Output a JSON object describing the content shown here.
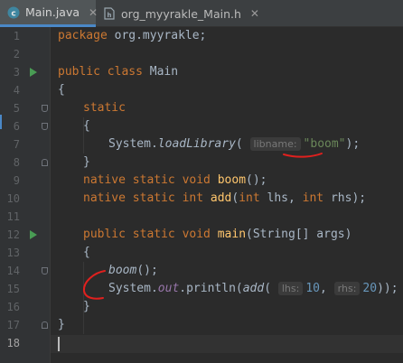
{
  "tabs": [
    {
      "label": "Main.java",
      "icon": "java-class-icon",
      "active": true
    },
    {
      "label": "org_myyrakle_Main.h",
      "icon": "header-file-icon",
      "active": false
    }
  ],
  "gutter": {
    "line_numbers": [
      "1",
      "2",
      "3",
      "4",
      "5",
      "6",
      "7",
      "8",
      "9",
      "10",
      "11",
      "12",
      "13",
      "14",
      "15",
      "16",
      "17",
      "18"
    ],
    "run_icon_lines": [
      3,
      12
    ],
    "current_line": 18
  },
  "code": {
    "l1_kw": "package",
    "l1_rest": " org.myyrakle;",
    "l3_kw1": "public",
    "l3_kw2": "class",
    "l3_name": "Main",
    "l4": "{",
    "l5_kw": "static",
    "l6": "{",
    "l7_cls": "System.",
    "l7_method": "loadLibrary",
    "l7_open": "(",
    "l7_hint": "libname:",
    "l7_str": "\"boom\"",
    "l7_close": ");",
    "l8": "}",
    "l9_kw": "native static void",
    "l9_fn": "boom",
    "l9_rest": "();",
    "l10_kw": "native static int",
    "l10_fn": "add",
    "l10_p1": "(",
    "l10_t1": "int",
    "l10_p2": " lhs, ",
    "l10_t2": "int",
    "l10_p3": " rhs);",
    "l12_kw": "public static void",
    "l12_fn": "main",
    "l12_rest": "(String[] args)",
    "l13": "{",
    "l14_call": "boom",
    "l14_rest": "();",
    "l15_cls": "System.",
    "l15_field": "out",
    "l15_mid": ".println(",
    "l15_call": "add",
    "l15_open": "(",
    "l15_hint1": "lhs:",
    "l15_n1": "10",
    "l15_sep": ", ",
    "l15_hint2": "rhs:",
    "l15_n2": "20",
    "l15_close": "));",
    "l16": "}",
    "l17": "}"
  },
  "annotations": {
    "color": "#e0201e"
  },
  "colors": {
    "keyword": "#cc7832",
    "function_decl": "#ffc66d",
    "string": "#6a8759",
    "number": "#6897bb",
    "field": "#9876aa",
    "default_text": "#a9b7c6",
    "run_icon": "#499c54",
    "tab_underline": "#4a88c7"
  }
}
